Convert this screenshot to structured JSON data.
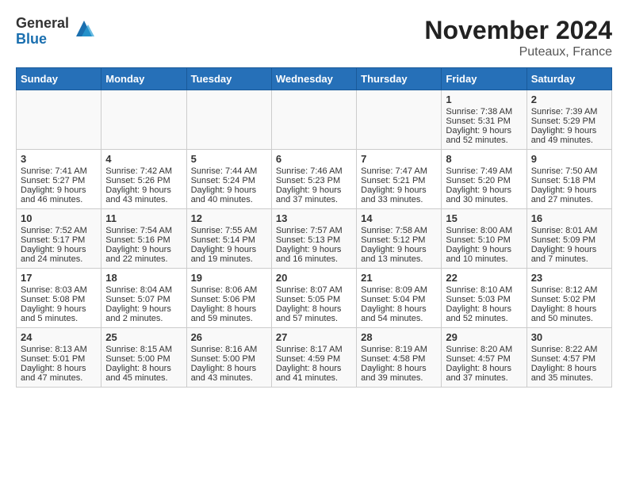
{
  "header": {
    "logo_general": "General",
    "logo_blue": "Blue",
    "title": "November 2024",
    "subtitle": "Puteaux, France"
  },
  "weekdays": [
    "Sunday",
    "Monday",
    "Tuesday",
    "Wednesday",
    "Thursday",
    "Friday",
    "Saturday"
  ],
  "weeks": [
    [
      {
        "day": "",
        "sunrise": "",
        "sunset": "",
        "daylight": ""
      },
      {
        "day": "",
        "sunrise": "",
        "sunset": "",
        "daylight": ""
      },
      {
        "day": "",
        "sunrise": "",
        "sunset": "",
        "daylight": ""
      },
      {
        "day": "",
        "sunrise": "",
        "sunset": "",
        "daylight": ""
      },
      {
        "day": "",
        "sunrise": "",
        "sunset": "",
        "daylight": ""
      },
      {
        "day": "1",
        "sunrise": "Sunrise: 7:38 AM",
        "sunset": "Sunset: 5:31 PM",
        "daylight": "Daylight: 9 hours and 52 minutes."
      },
      {
        "day": "2",
        "sunrise": "Sunrise: 7:39 AM",
        "sunset": "Sunset: 5:29 PM",
        "daylight": "Daylight: 9 hours and 49 minutes."
      }
    ],
    [
      {
        "day": "3",
        "sunrise": "Sunrise: 7:41 AM",
        "sunset": "Sunset: 5:27 PM",
        "daylight": "Daylight: 9 hours and 46 minutes."
      },
      {
        "day": "4",
        "sunrise": "Sunrise: 7:42 AM",
        "sunset": "Sunset: 5:26 PM",
        "daylight": "Daylight: 9 hours and 43 minutes."
      },
      {
        "day": "5",
        "sunrise": "Sunrise: 7:44 AM",
        "sunset": "Sunset: 5:24 PM",
        "daylight": "Daylight: 9 hours and 40 minutes."
      },
      {
        "day": "6",
        "sunrise": "Sunrise: 7:46 AM",
        "sunset": "Sunset: 5:23 PM",
        "daylight": "Daylight: 9 hours and 37 minutes."
      },
      {
        "day": "7",
        "sunrise": "Sunrise: 7:47 AM",
        "sunset": "Sunset: 5:21 PM",
        "daylight": "Daylight: 9 hours and 33 minutes."
      },
      {
        "day": "8",
        "sunrise": "Sunrise: 7:49 AM",
        "sunset": "Sunset: 5:20 PM",
        "daylight": "Daylight: 9 hours and 30 minutes."
      },
      {
        "day": "9",
        "sunrise": "Sunrise: 7:50 AM",
        "sunset": "Sunset: 5:18 PM",
        "daylight": "Daylight: 9 hours and 27 minutes."
      }
    ],
    [
      {
        "day": "10",
        "sunrise": "Sunrise: 7:52 AM",
        "sunset": "Sunset: 5:17 PM",
        "daylight": "Daylight: 9 hours and 24 minutes."
      },
      {
        "day": "11",
        "sunrise": "Sunrise: 7:54 AM",
        "sunset": "Sunset: 5:16 PM",
        "daylight": "Daylight: 9 hours and 22 minutes."
      },
      {
        "day": "12",
        "sunrise": "Sunrise: 7:55 AM",
        "sunset": "Sunset: 5:14 PM",
        "daylight": "Daylight: 9 hours and 19 minutes."
      },
      {
        "day": "13",
        "sunrise": "Sunrise: 7:57 AM",
        "sunset": "Sunset: 5:13 PM",
        "daylight": "Daylight: 9 hours and 16 minutes."
      },
      {
        "day": "14",
        "sunrise": "Sunrise: 7:58 AM",
        "sunset": "Sunset: 5:12 PM",
        "daylight": "Daylight: 9 hours and 13 minutes."
      },
      {
        "day": "15",
        "sunrise": "Sunrise: 8:00 AM",
        "sunset": "Sunset: 5:10 PM",
        "daylight": "Daylight: 9 hours and 10 minutes."
      },
      {
        "day": "16",
        "sunrise": "Sunrise: 8:01 AM",
        "sunset": "Sunset: 5:09 PM",
        "daylight": "Daylight: 9 hours and 7 minutes."
      }
    ],
    [
      {
        "day": "17",
        "sunrise": "Sunrise: 8:03 AM",
        "sunset": "Sunset: 5:08 PM",
        "daylight": "Daylight: 9 hours and 5 minutes."
      },
      {
        "day": "18",
        "sunrise": "Sunrise: 8:04 AM",
        "sunset": "Sunset: 5:07 PM",
        "daylight": "Daylight: 9 hours and 2 minutes."
      },
      {
        "day": "19",
        "sunrise": "Sunrise: 8:06 AM",
        "sunset": "Sunset: 5:06 PM",
        "daylight": "Daylight: 8 hours and 59 minutes."
      },
      {
        "day": "20",
        "sunrise": "Sunrise: 8:07 AM",
        "sunset": "Sunset: 5:05 PM",
        "daylight": "Daylight: 8 hours and 57 minutes."
      },
      {
        "day": "21",
        "sunrise": "Sunrise: 8:09 AM",
        "sunset": "Sunset: 5:04 PM",
        "daylight": "Daylight: 8 hours and 54 minutes."
      },
      {
        "day": "22",
        "sunrise": "Sunrise: 8:10 AM",
        "sunset": "Sunset: 5:03 PM",
        "daylight": "Daylight: 8 hours and 52 minutes."
      },
      {
        "day": "23",
        "sunrise": "Sunrise: 8:12 AM",
        "sunset": "Sunset: 5:02 PM",
        "daylight": "Daylight: 8 hours and 50 minutes."
      }
    ],
    [
      {
        "day": "24",
        "sunrise": "Sunrise: 8:13 AM",
        "sunset": "Sunset: 5:01 PM",
        "daylight": "Daylight: 8 hours and 47 minutes."
      },
      {
        "day": "25",
        "sunrise": "Sunrise: 8:15 AM",
        "sunset": "Sunset: 5:00 PM",
        "daylight": "Daylight: 8 hours and 45 minutes."
      },
      {
        "day": "26",
        "sunrise": "Sunrise: 8:16 AM",
        "sunset": "Sunset: 5:00 PM",
        "daylight": "Daylight: 8 hours and 43 minutes."
      },
      {
        "day": "27",
        "sunrise": "Sunrise: 8:17 AM",
        "sunset": "Sunset: 4:59 PM",
        "daylight": "Daylight: 8 hours and 41 minutes."
      },
      {
        "day": "28",
        "sunrise": "Sunrise: 8:19 AM",
        "sunset": "Sunset: 4:58 PM",
        "daylight": "Daylight: 8 hours and 39 minutes."
      },
      {
        "day": "29",
        "sunrise": "Sunrise: 8:20 AM",
        "sunset": "Sunset: 4:57 PM",
        "daylight": "Daylight: 8 hours and 37 minutes."
      },
      {
        "day": "30",
        "sunrise": "Sunrise: 8:22 AM",
        "sunset": "Sunset: 4:57 PM",
        "daylight": "Daylight: 8 hours and 35 minutes."
      }
    ]
  ]
}
